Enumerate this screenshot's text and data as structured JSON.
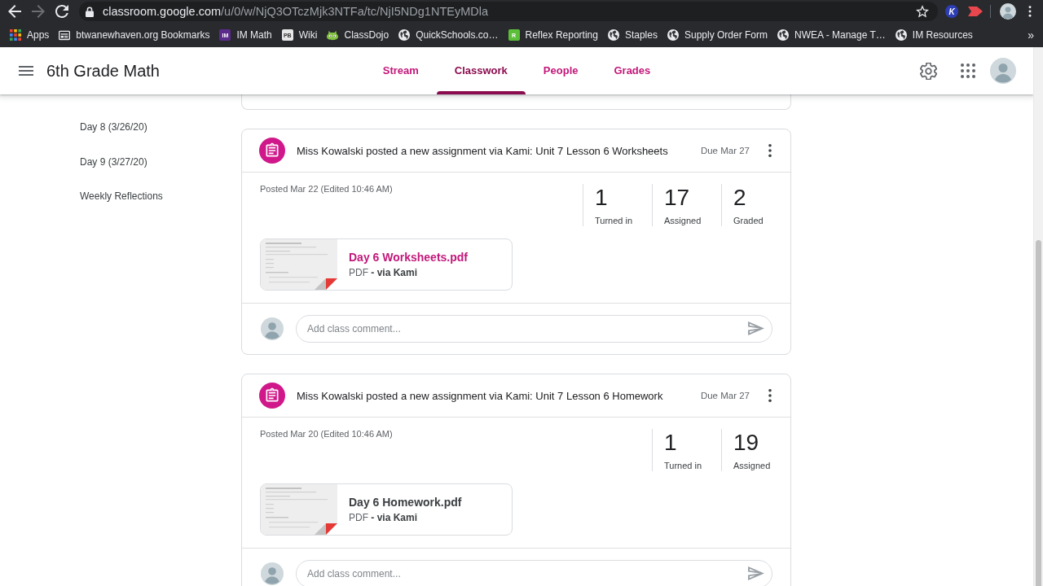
{
  "browser": {
    "url": {
      "host": "classroom.google.com",
      "path": "/u/0/w/NjQ3OTczMjk3NTFa/tc/NjI5NDg1NTEyMDla"
    },
    "forward_disabled": true,
    "extensions": [
      {
        "kind": "letter",
        "icon_text": "K",
        "color": "#2d3db4"
      },
      {
        "kind": "arrow"
      }
    ]
  },
  "bookmarks": {
    "items": [
      {
        "label": "Apps",
        "kind": "apps"
      },
      {
        "label": "btwanewhaven.org Bookmarks",
        "kind": "folder"
      },
      {
        "label": "IM Math",
        "kind": "tile",
        "icon_text": "IM",
        "color": "#5b2b8c"
      },
      {
        "label": "Wiki",
        "kind": "tile",
        "icon_text": "PB",
        "color": "#e8e8e8"
      },
      {
        "label": "ClassDojo",
        "kind": "creature"
      },
      {
        "label": "QuickSchools.co…",
        "kind": "globe"
      },
      {
        "label": "Reflex Reporting",
        "kind": "tile",
        "icon_text": "R",
        "color": "#5cbf3a"
      },
      {
        "label": "Staples",
        "kind": "globe"
      },
      {
        "label": "Supply Order Form",
        "kind": "globe"
      },
      {
        "label": "NWEA - Manage T…",
        "kind": "globe"
      },
      {
        "label": "IM Resources",
        "kind": "globe"
      }
    ],
    "overflow": "»"
  },
  "header": {
    "title": "6th Grade Math",
    "tabs": [
      {
        "label": "Stream",
        "selected": false
      },
      {
        "label": "Classwork",
        "selected": true
      },
      {
        "label": "People",
        "selected": false
      },
      {
        "label": "Grades",
        "selected": false
      }
    ]
  },
  "sidebar": {
    "items": [
      {
        "label": "Day 8 (3/26/20)",
        "selected": false
      },
      {
        "label": "Day 9 (3/27/20)",
        "selected": false
      },
      {
        "label": "Weekly Reflections",
        "selected": false
      }
    ]
  },
  "posts": [
    {
      "title": "Miss Kowalski posted a new assignment via Kami: Unit 7 Lesson 6 Worksheets",
      "due": "Due Mar 27",
      "posted": "Posted Mar 22 (Edited 10:46 AM)",
      "stats": [
        {
          "value": "1",
          "label": "Turned in"
        },
        {
          "value": "17",
          "label": "Assigned"
        },
        {
          "value": "2",
          "label": "Graded"
        }
      ],
      "attachment": {
        "name": "Day 6 Worksheets.pdf",
        "meta": "PDF **- via Kami**",
        "highlighted": true
      },
      "comment_placeholder": "Add class comment..."
    },
    {
      "title": "Miss Kowalski posted a new assignment via Kami: Unit 7 Lesson 6 Homework",
      "due": "Due Mar 27",
      "posted": "Posted Mar 20 (Edited 10:46 AM)",
      "stats": [
        {
          "value": "1",
          "label": "Turned in"
        },
        {
          "value": "19",
          "label": "Assigned"
        }
      ],
      "attachment": {
        "name": "Day 6 Homework.pdf",
        "meta": "PDF **- via Kami**",
        "highlighted": false
      },
      "comment_placeholder": "Add class comment..."
    }
  ]
}
